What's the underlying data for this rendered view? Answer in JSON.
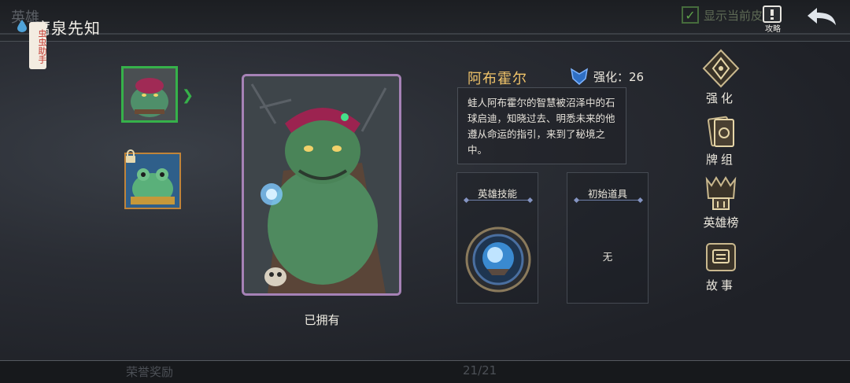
{
  "header": {
    "tab_ghost": "英雄",
    "title": "腐泉先知",
    "helper_tag": "虫虫助手",
    "show_current_label": "显示当前皮肤",
    "guide_label": "攻略"
  },
  "hero": {
    "name": "阿布霍尔",
    "enhance_label": "强化：26",
    "description": "蛙人阿布霍尔的智慧被沼泽中的石球启迪，知晓过去、明悉未来的他遵从命运的指引，来到了秘境之中。",
    "status": "已拥有"
  },
  "panels": {
    "skill_title": "英雄技能",
    "item_title": "初始道具",
    "item_value": "无"
  },
  "side_menu": [
    {
      "label": "强化",
      "icon": "enhance-icon"
    },
    {
      "label": "牌组",
      "icon": "deck-icon"
    },
    {
      "label": "英雄榜",
      "icon": "leaderboard-icon"
    },
    {
      "label": "故事",
      "icon": "story-icon"
    }
  ],
  "footer": {
    "honor_label": "荣誉奖励",
    "page_counter": "21/21"
  },
  "colors": {
    "accent_gold": "#f1c46a",
    "selected_green": "#36b14a",
    "card_border": "#a682b6"
  }
}
